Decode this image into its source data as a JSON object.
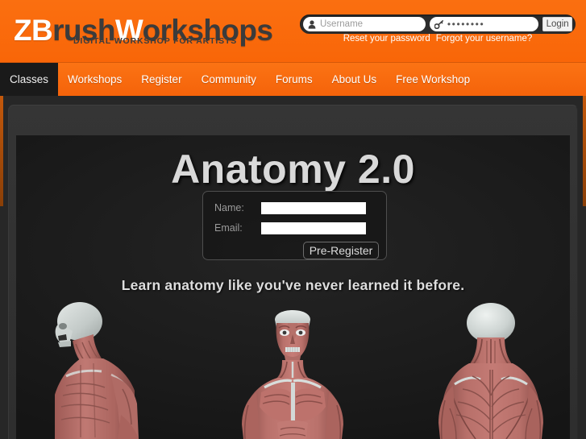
{
  "site": {
    "logo": {
      "part1": "ZB",
      "part2": "rush",
      "part3": "W",
      "part4": "orkshops",
      "full_text": "ZBrushWorkshops",
      "tagline": "DIGITAL WORKSHOP FOR ARTISTS"
    },
    "brand_color": "#f96a0a",
    "nav_active_color": "#1a1a1a"
  },
  "login": {
    "username_placeholder": "Username",
    "username_value": "",
    "username_icon": "user-icon",
    "password_value": "••••••••",
    "password_icon": "key-icon",
    "login_label": "Login",
    "reset_password_label": "Reset your password",
    "forgot_username_label": "Forgot your username?"
  },
  "nav": {
    "items": [
      {
        "label": "Classes",
        "active": true
      },
      {
        "label": "Workshops",
        "active": false
      },
      {
        "label": "Register",
        "active": false
      },
      {
        "label": "Community",
        "active": false
      },
      {
        "label": "Forums",
        "active": false
      },
      {
        "label": "About Us",
        "active": false
      },
      {
        "label": "Free Workshop",
        "active": false
      }
    ]
  },
  "hero": {
    "title": "Anatomy 2.0",
    "tagline": "Learn anatomy like you've never learned it before.",
    "form": {
      "name_label": "Name:",
      "name_value": "",
      "email_label": "Email:",
      "email_value": "",
      "submit_label": "Pre-Register"
    },
    "figures": [
      {
        "name": "ecorche-side-view",
        "view": "side"
      },
      {
        "name": "ecorche-front-view",
        "view": "front"
      },
      {
        "name": "ecorche-back-view",
        "view": "back"
      }
    ],
    "muscle_color": "#bd6d67",
    "bone_color": "#cfd4d2",
    "background_color": "#1e1e1e"
  }
}
